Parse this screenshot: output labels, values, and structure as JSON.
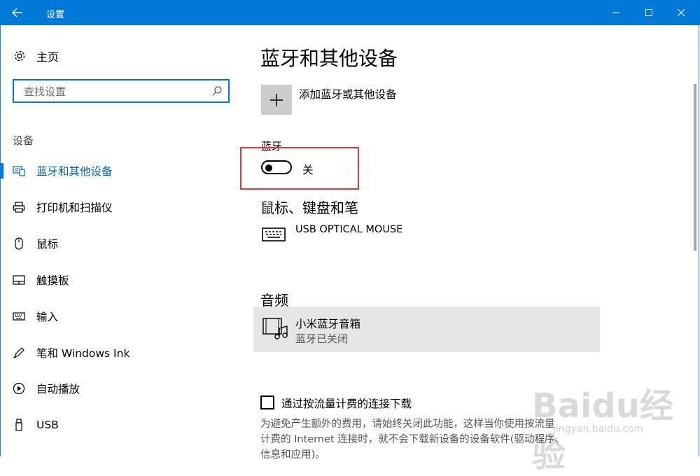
{
  "window": {
    "title": "设置",
    "minimize_icon": "minimize-icon",
    "maximize_icon": "maximize-icon",
    "close_icon": "close-icon",
    "accent": "#0078d7"
  },
  "sidebar": {
    "home_label": "主页",
    "search_placeholder": "查找设置",
    "section": "设备",
    "items": [
      {
        "label": "蓝牙和其他设备",
        "icon": "bluetooth-devices-icon",
        "active": true
      },
      {
        "label": "打印机和扫描仪",
        "icon": "printer-icon"
      },
      {
        "label": "鼠标",
        "icon": "mouse-icon"
      },
      {
        "label": "触摸板",
        "icon": "touchpad-icon"
      },
      {
        "label": "输入",
        "icon": "keyboard-icon"
      },
      {
        "label": "笔和 Windows Ink",
        "icon": "pen-icon"
      },
      {
        "label": "自动播放",
        "icon": "autoplay-icon"
      },
      {
        "label": "USB",
        "icon": "usb-icon"
      }
    ]
  },
  "main": {
    "title": "蓝牙和其他设备",
    "add_device_label": "添加蓝牙或其他设备",
    "bluetooth": {
      "label": "蓝牙",
      "state": "关",
      "on": false
    },
    "input_section": {
      "title": "鼠标、键盘和笔",
      "device": "USB OPTICAL MOUSE"
    },
    "audio_section": {
      "title": "音频",
      "device": "小米蓝牙音箱",
      "status": "蓝牙已关闭"
    },
    "metered": {
      "label": "通过按流量计费的连接下载",
      "checked": false,
      "description_line1": "为避免产生额外的费用，请始终关闭此功能，这样当你使用按流量",
      "description_line2": "计费的 Internet 连接时，就不会下载新设备的设备软件(驱动程序、",
      "description_line3": "信息和应用)。"
    }
  },
  "watermark": {
    "text": "Baidu经验",
    "url": "jingyan.baidu.com"
  },
  "colors": {
    "highlight_box": "#e53935",
    "active_nav": "#0063b1",
    "card_bg": "#e6e6e6"
  }
}
